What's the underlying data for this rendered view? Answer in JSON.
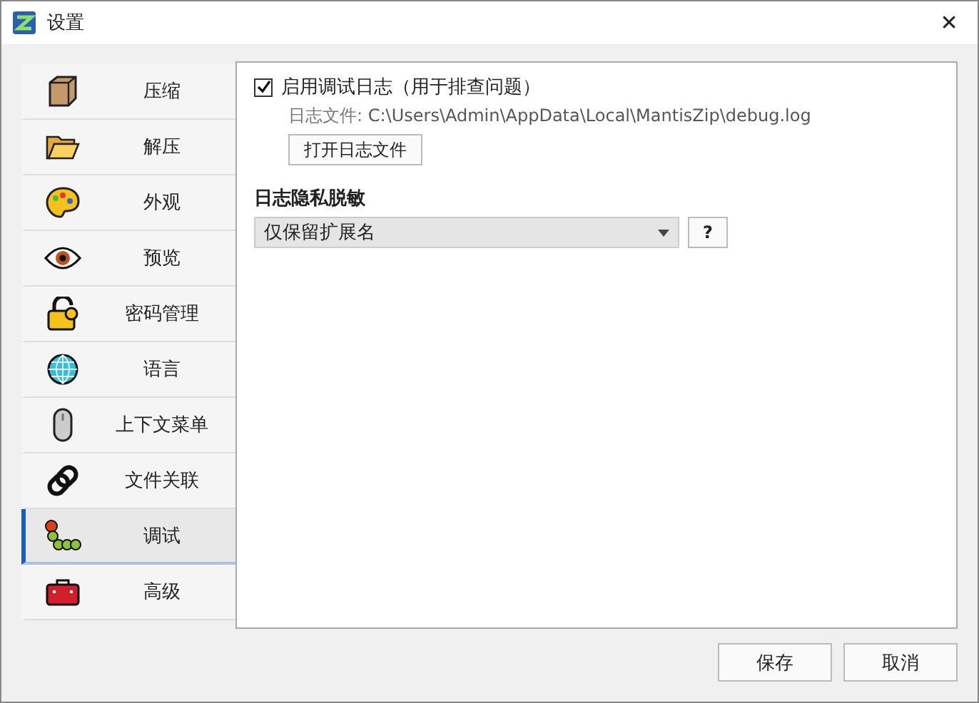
{
  "window": {
    "title": "设置",
    "close": "✕"
  },
  "sidebar": {
    "items": [
      {
        "label": "压缩",
        "selected": false
      },
      {
        "label": "解压",
        "selected": false
      },
      {
        "label": "外观",
        "selected": false
      },
      {
        "label": "预览",
        "selected": false
      },
      {
        "label": "密码管理",
        "selected": false
      },
      {
        "label": "语言",
        "selected": false
      },
      {
        "label": "上下文菜单",
        "selected": false
      },
      {
        "label": "文件关联",
        "selected": false
      },
      {
        "label": "调试",
        "selected": true
      },
      {
        "label": "高级",
        "selected": false
      }
    ]
  },
  "debug": {
    "enable_log": {
      "label": "启用调试日志（用于排查问题）",
      "checked": true
    },
    "log_file": {
      "label": "日志文件:",
      "path": "C:\\Users\\Admin\\AppData\\Local\\MantisZip\\debug.log"
    },
    "open_button": "打开日志文件",
    "privacy": {
      "heading": "日志隐私脱敏",
      "value": "仅保留扩展名",
      "help_button": "?"
    }
  },
  "buttons": [
    "保存",
    "取消"
  ]
}
